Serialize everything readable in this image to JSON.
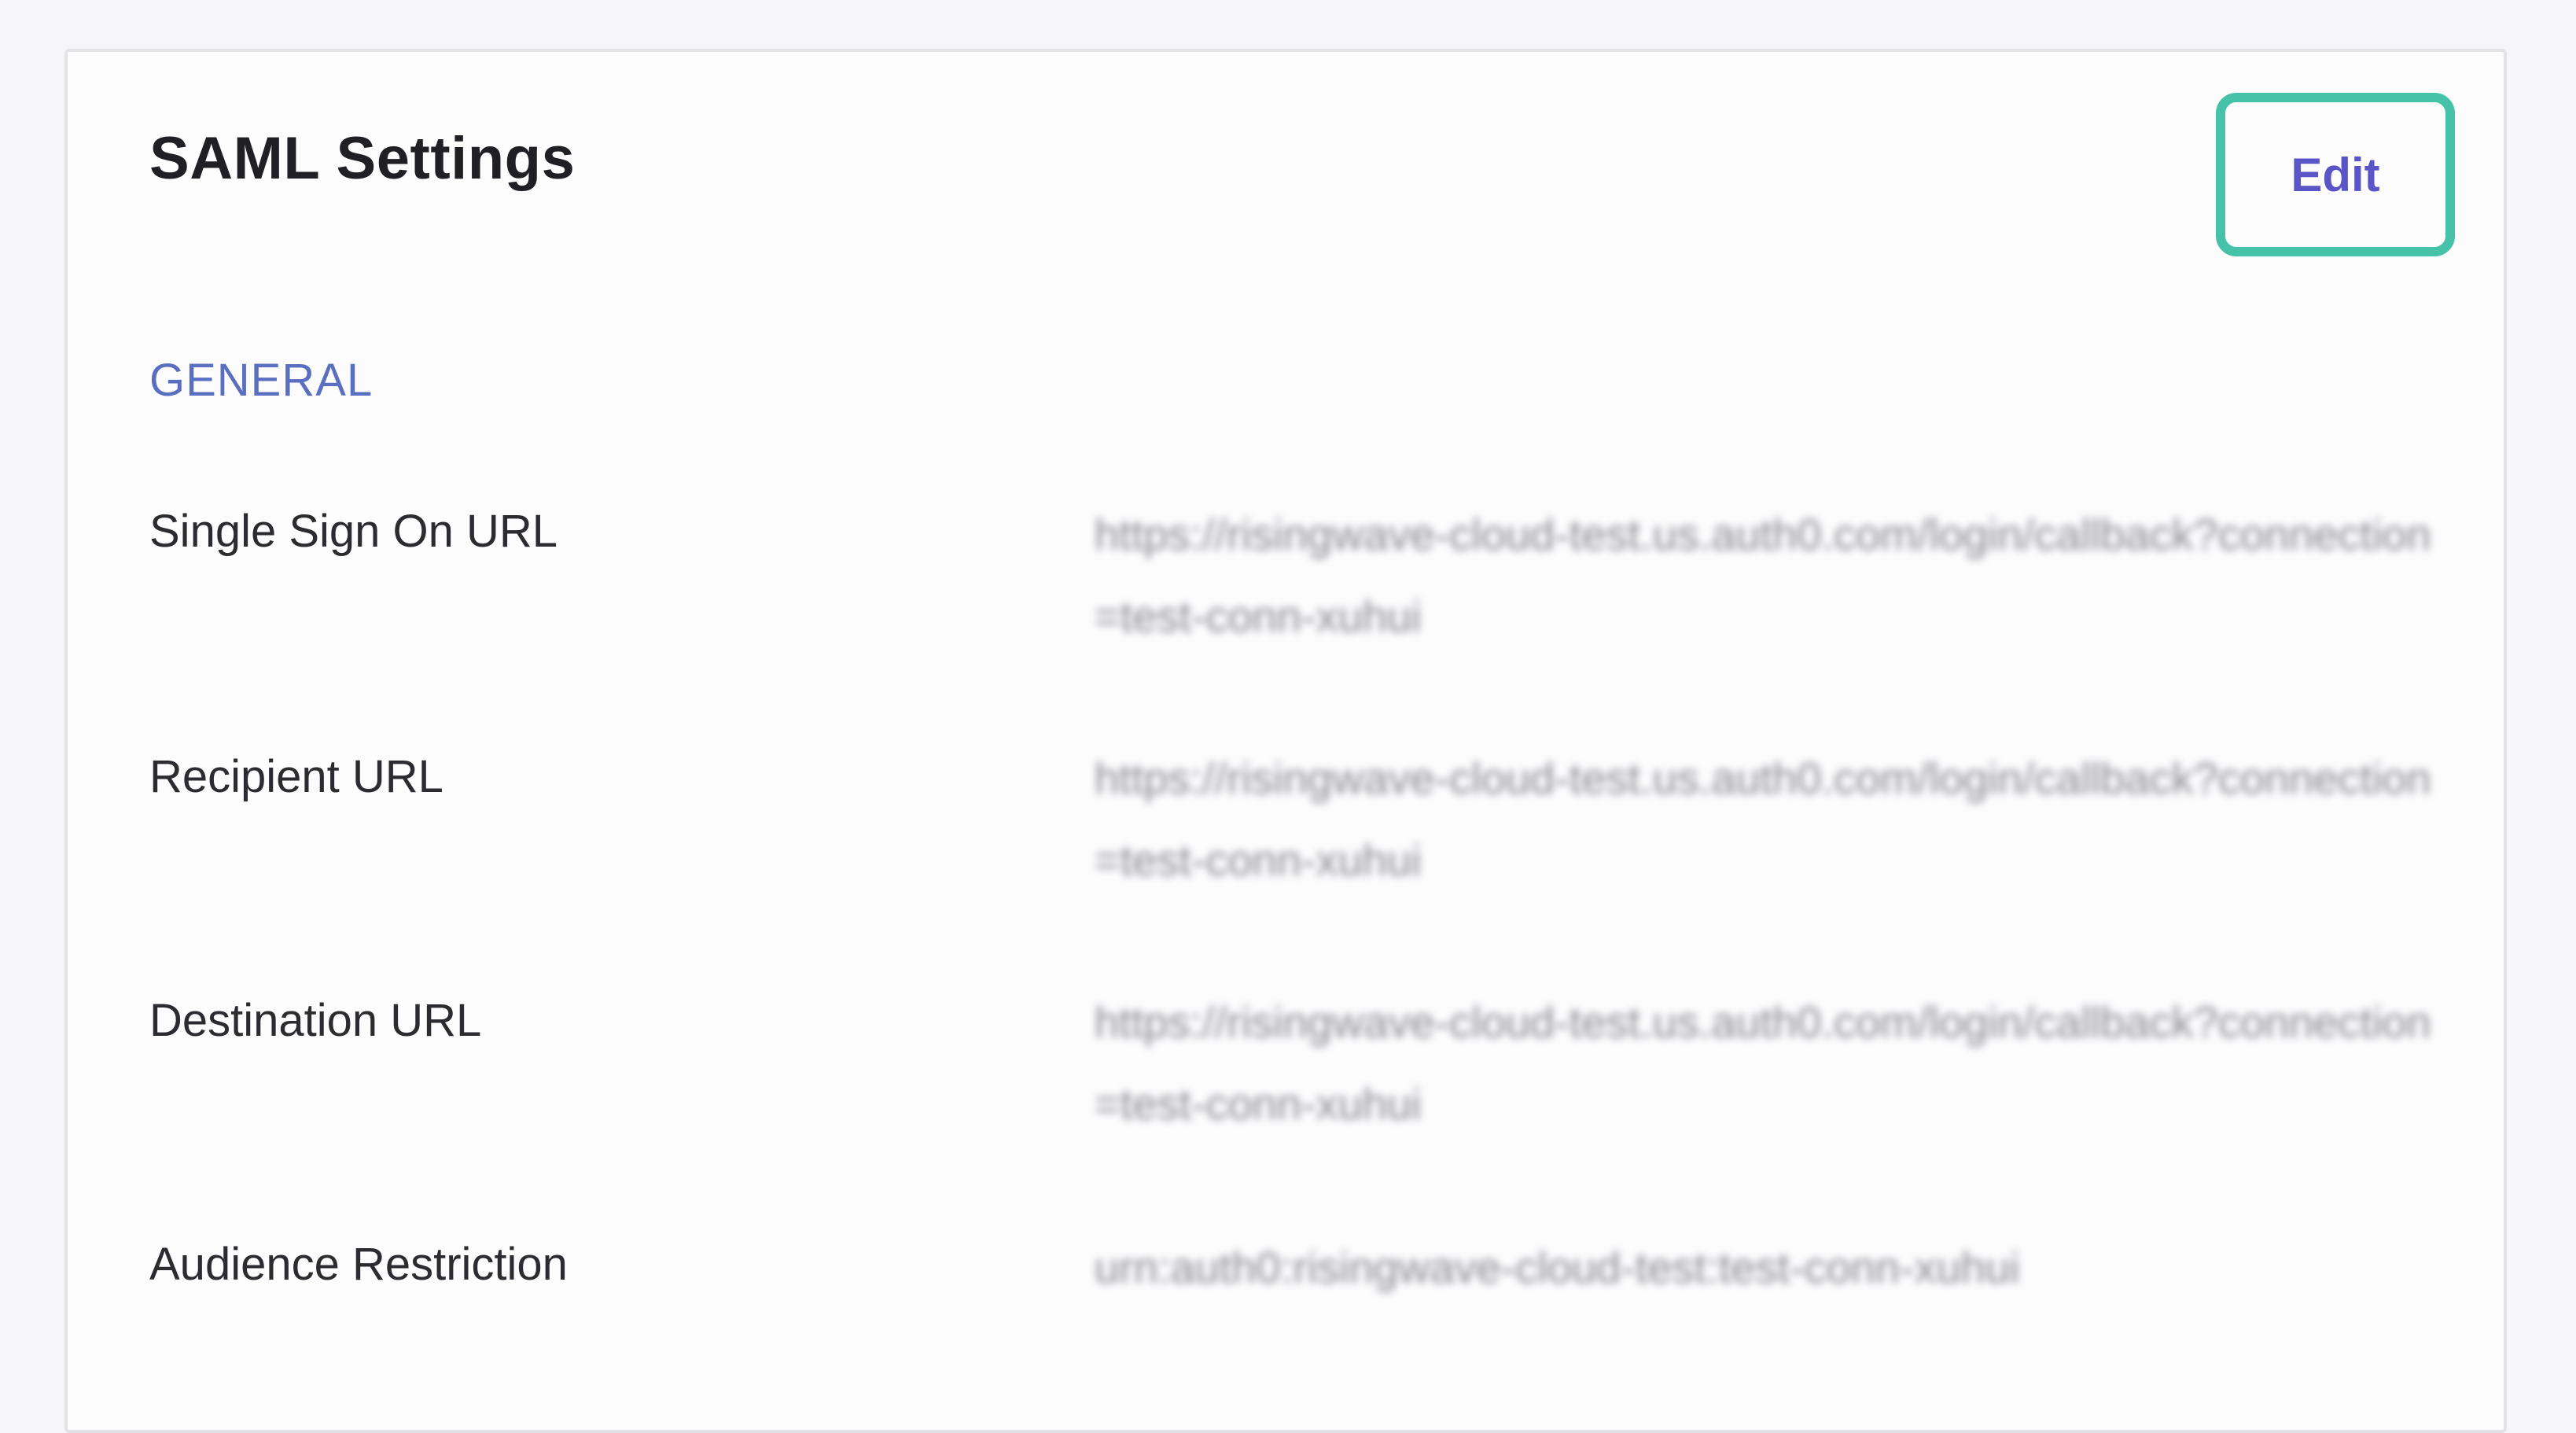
{
  "card": {
    "title": "SAML Settings",
    "edit_label": "Edit",
    "section_title": "GENERAL",
    "rows": [
      {
        "label": "Single Sign On URL",
        "value": "https://risingwave-cloud-test.us.auth0.com/login/callback?connection=test-conn-xuhui"
      },
      {
        "label": "Recipient URL",
        "value": "https://risingwave-cloud-test.us.auth0.com/login/callback?connection=test-conn-xuhui"
      },
      {
        "label": "Destination URL",
        "value": "https://risingwave-cloud-test.us.auth0.com/login/callback?connection=test-conn-xuhui"
      },
      {
        "label": "Audience Restriction",
        "value": "urn:auth0:risingwave-cloud-test:test-conn-xuhui"
      }
    ]
  },
  "colors": {
    "highlight": "#45c2a8",
    "accent": "#5a55c7",
    "section": "#5b6fc0"
  }
}
